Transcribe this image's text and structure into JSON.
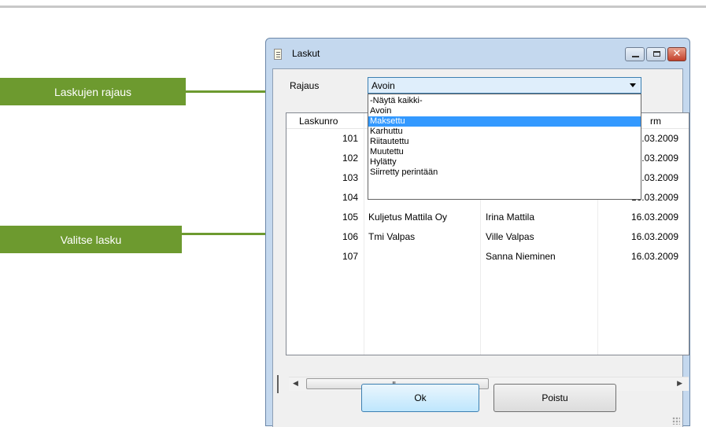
{
  "callouts": {
    "filter": "Laskujen rajaus",
    "select": "Valitse lasku"
  },
  "window": {
    "title": "Laskut",
    "close_glyph": "✕"
  },
  "filter": {
    "label": "Rajaus",
    "value": "Avoin",
    "options": [
      "-Näytä kaikki-",
      "Avoin",
      "Maksettu",
      "Karhuttu",
      "Riitautettu",
      "Muutettu",
      "Hylätty",
      "Siirretty perintään"
    ],
    "highlighted": "Maksettu"
  },
  "grid": {
    "headers": {
      "number": "Laskunro",
      "date_partial": "rm"
    },
    "rows": [
      {
        "number": "101",
        "customer": "",
        "contact": "",
        "date": "16.03.2009"
      },
      {
        "number": "102",
        "customer": "",
        "contact": "",
        "date": "16.03.2009"
      },
      {
        "number": "103",
        "customer": "",
        "contact": "",
        "date": "16.03.2009"
      },
      {
        "number": "104",
        "customer": "",
        "contact": "",
        "date": "16.03.2009"
      },
      {
        "number": "105",
        "customer": "Kuljetus Mattila Oy",
        "contact": "Irina Mattila",
        "date": "16.03.2009"
      },
      {
        "number": "106",
        "customer": "Tmi Valpas",
        "contact": "Ville Valpas",
        "date": "16.03.2009"
      },
      {
        "number": "107",
        "customer": "",
        "contact": "Sanna Nieminen",
        "date": "16.03.2009"
      }
    ],
    "visible_dates": [
      "3.2009",
      "3.2009",
      "3.2009",
      "3.2009"
    ]
  },
  "scrollbar": {
    "left": "◀",
    "right": "▶",
    "grip": "III"
  },
  "buttons": {
    "ok": "Ok",
    "cancel": "Poistu"
  },
  "colors": {
    "callout": "#6d9a2f",
    "selection": "#3399ff"
  }
}
